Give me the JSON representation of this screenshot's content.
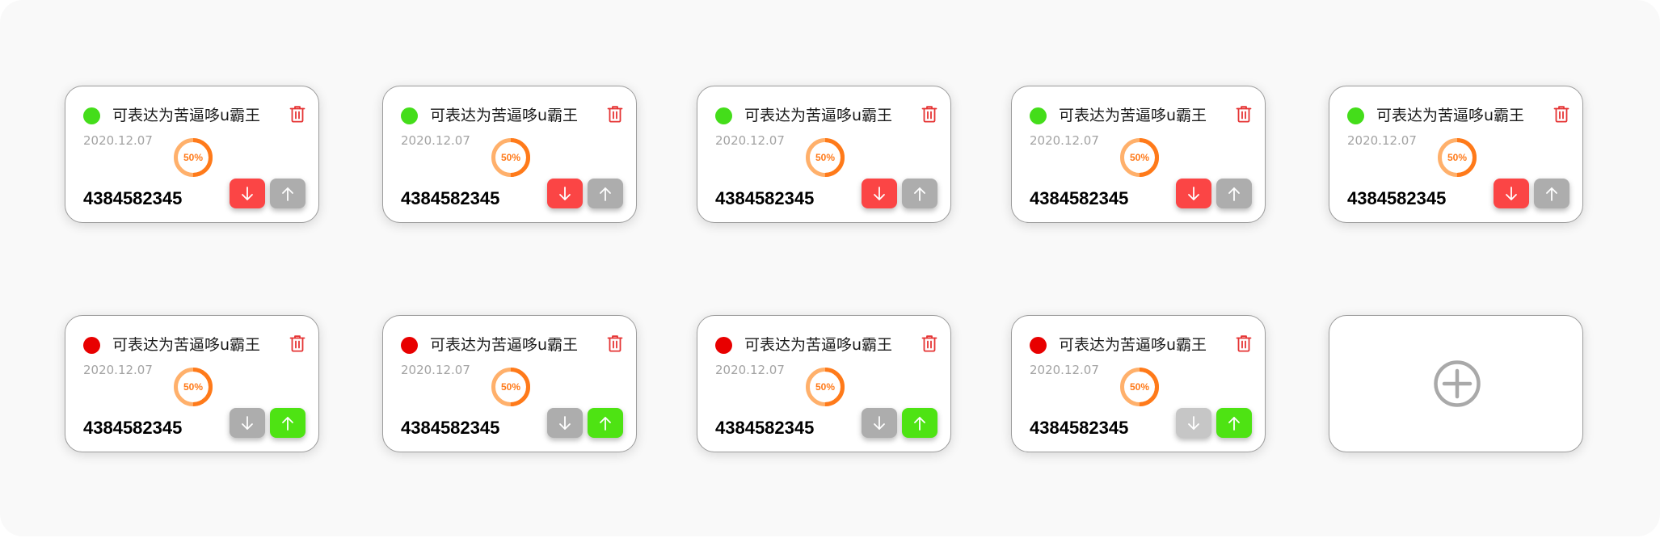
{
  "colors": {
    "online": "#44dd1a",
    "offline": "#e80000",
    "download_active": "#fb4545",
    "upload_active": "#4ee313",
    "button_inactive": "#adadad",
    "button_inactive_light": "#c6c6c6",
    "trash": "#e53333",
    "progress_light": "#ffb06b",
    "progress_dark": "#ff7a1a"
  },
  "cards": [
    {
      "status": "online",
      "title": "可表达为苦逼哆u霸王",
      "date": "2020.12.07",
      "progress": 50,
      "progress_label": "50%",
      "number": "4384582345",
      "download_state": "active",
      "upload_state": "inactive"
    },
    {
      "status": "online",
      "title": "可表达为苦逼哆u霸王",
      "date": "2020.12.07",
      "progress": 50,
      "progress_label": "50%",
      "number": "4384582345",
      "download_state": "active",
      "upload_state": "inactive"
    },
    {
      "status": "online",
      "title": "可表达为苦逼哆u霸王",
      "date": "2020.12.07",
      "progress": 50,
      "progress_label": "50%",
      "number": "4384582345",
      "download_state": "active",
      "upload_state": "inactive"
    },
    {
      "status": "online",
      "title": "可表达为苦逼哆u霸王",
      "date": "2020.12.07",
      "progress": 50,
      "progress_label": "50%",
      "number": "4384582345",
      "download_state": "active",
      "upload_state": "inactive"
    },
    {
      "status": "online",
      "title": "可表达为苦逼哆u霸王",
      "date": "2020.12.07",
      "progress": 50,
      "progress_label": "50%",
      "number": "4384582345",
      "download_state": "active",
      "upload_state": "inactive"
    },
    {
      "status": "offline",
      "title": "可表达为苦逼哆u霸王",
      "date": "2020.12.07",
      "progress": 50,
      "progress_label": "50%",
      "number": "4384582345",
      "download_state": "inactive",
      "upload_state": "active"
    },
    {
      "status": "offline",
      "title": "可表达为苦逼哆u霸王",
      "date": "2020.12.07",
      "progress": 50,
      "progress_label": "50%",
      "number": "4384582345",
      "download_state": "inactive",
      "upload_state": "active"
    },
    {
      "status": "offline",
      "title": "可表达为苦逼哆u霸王",
      "date": "2020.12.07",
      "progress": 50,
      "progress_label": "50%",
      "number": "4384582345",
      "download_state": "inactive",
      "upload_state": "active"
    },
    {
      "status": "offline",
      "title": "可表达为苦逼哆u霸王",
      "date": "2020.12.07",
      "progress": 50,
      "progress_label": "50%",
      "number": "4384582345",
      "download_state": "inactive-light",
      "upload_state": "active"
    }
  ],
  "icons": {
    "status": "status-dot",
    "delete": "trash-icon",
    "download": "arrow-down-icon",
    "upload": "arrow-up-icon",
    "add": "plus-circle-icon"
  }
}
